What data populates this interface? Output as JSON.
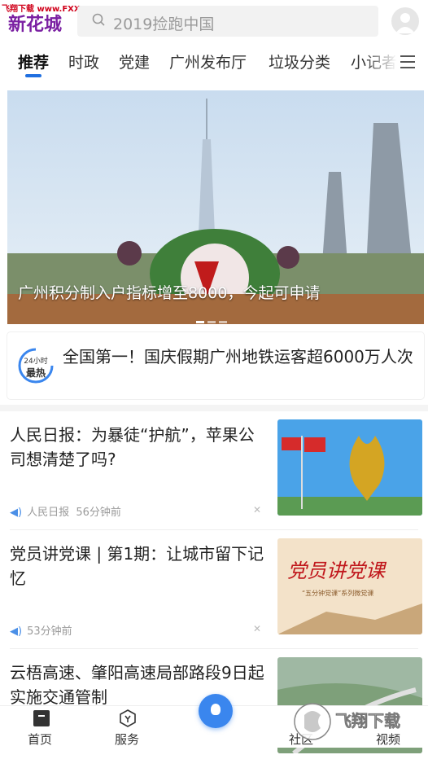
{
  "watermark": "飞翔下载 www.FXXZ.com",
  "header": {
    "logo": "新花城",
    "search_placeholder": "2019捡跑中国"
  },
  "tabs": [
    "推荐",
    "时政",
    "党建",
    "广州发布厅",
    "垃圾分类",
    "小记者"
  ],
  "hero": {
    "caption": "广州积分制入户指标增至8000，今起可申请"
  },
  "hot": {
    "badge_top": "24小时",
    "badge_bottom": "最热",
    "title": "全国第一！国庆假期广州地铁运客超6000万人次"
  },
  "news": [
    {
      "title": "人民日报：为暴徒“护航”，苹果公司想清楚了吗?",
      "source": "人民日报",
      "time": "56分钟前"
    },
    {
      "title": "党员讲党课 | 第1期：让城市留下记忆",
      "source": "",
      "time": "53分钟前",
      "thumb_text": "党员讲党课",
      "thumb_sub": "“五分钟党课”系列微党课"
    },
    {
      "title": "云梧高速、肇阳高速局部路段9日起实施交通管制",
      "source": "",
      "time": ""
    }
  ],
  "bottom_nav": [
    "首页",
    "服务",
    "社区",
    "视频"
  ],
  "fx_logo": "飞翔下载",
  "colors": {
    "accent": "#1f6fe0",
    "logo": "#7a1fa2",
    "center": "#3a86ee"
  }
}
